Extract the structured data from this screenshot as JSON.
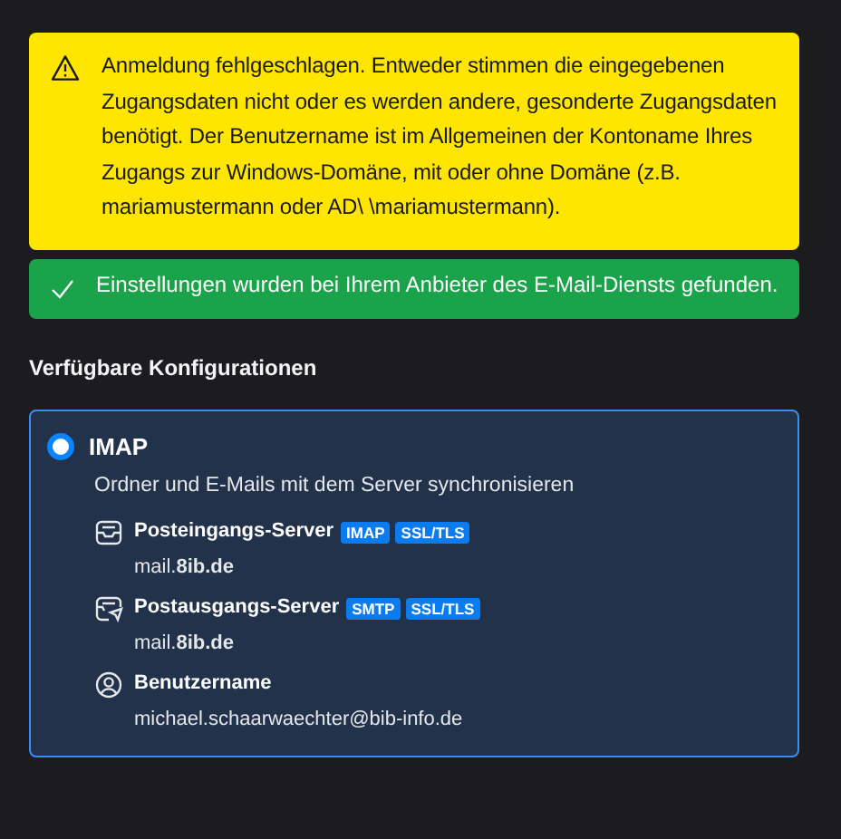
{
  "warning": {
    "text": "Anmeldung fehlgeschlagen. Entweder stimmen die eingegebenen Zugangsdaten nicht oder es werden andere, gesonderte Zugangsdaten benötigt. Der Benutzername ist im Allgemeinen der Kontoname Ihres Zugangs zur Windows-Domäne, mit oder ohne Domäne (z.B. mariamustermann oder AD\\ \\mariamustermann)."
  },
  "success": {
    "text": "Einstellungen wurden bei Ihrem Anbieter des E-Mail-Diensts gefunden."
  },
  "section_title": "Verfügbare Konfigurationen",
  "configurations": [
    {
      "title": "IMAP",
      "selected": true,
      "description": "Ordner und E-Mails mit dem Server synchronisieren",
      "details": [
        {
          "kind": "incoming",
          "label": "Posteingangs-Server",
          "tags": [
            "IMAP",
            "SSL/TLS"
          ],
          "value": "mail.**8ib.de**"
        },
        {
          "kind": "outgoing",
          "label": "Postausgangs-Server",
          "tags": [
            "SMTP",
            "SSL/TLS"
          ],
          "value": "mail.**8ib.de**"
        },
        {
          "kind": "user",
          "label": "Benutzername",
          "value": "michael.schaarwaechter@bib-info.de"
        }
      ]
    }
  ]
}
